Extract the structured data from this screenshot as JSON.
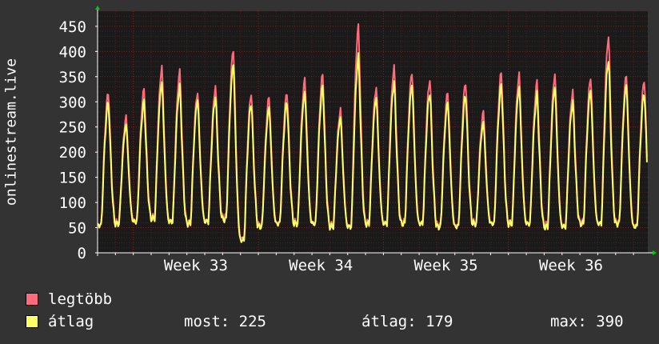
{
  "chart_data": {
    "type": "line",
    "ylabel": "onlinestream.live",
    "ylim": [
      0,
      480
    ],
    "yticks": [
      0,
      50,
      100,
      150,
      200,
      250,
      300,
      350,
      400,
      450
    ],
    "x_tick_labels": [
      "Week 33",
      "Week 34",
      "Week 35",
      "Week 36"
    ],
    "x_tick_days": [
      2,
      9,
      16,
      23
    ],
    "x_range_days": [
      0,
      30.8
    ],
    "grid": true,
    "colors": {
      "max": "#ff6b7a",
      "avg": "#ffff66",
      "grid": "#8b1a1a",
      "axis": "#ffffff",
      "plot_bg": "#1a1a1a",
      "page_bg": "#333333"
    },
    "series": [
      {
        "name": "legtöbb",
        "daily_peaks": [
          320,
          270,
          325,
          370,
          360,
          320,
          330,
          405,
          318,
          310,
          320,
          345,
          355,
          285,
          450,
          330,
          370,
          360,
          345,
          320,
          340,
          280,
          360,
          355,
          340,
          355,
          320,
          350,
          430,
          355,
          345,
          320,
          270
        ],
        "daily_troughs": [
          55,
          60,
          65,
          70,
          65,
          60,
          65,
          70,
          30,
          55,
          60,
          60,
          60,
          55,
          55,
          60,
          60,
          60,
          60,
          55,
          55,
          60,
          60,
          60,
          60,
          55,
          55,
          60,
          60,
          60,
          55,
          55,
          60
        ]
      },
      {
        "name": "átlag",
        "daily_peaks": [
          300,
          255,
          300,
          340,
          330,
          305,
          310,
          375,
          300,
          290,
          300,
          320,
          330,
          270,
          390,
          310,
          340,
          335,
          320,
          300,
          315,
          260,
          335,
          330,
          315,
          330,
          300,
          325,
          385,
          335,
          320,
          300,
          225
        ],
        "daily_troughs": [
          55,
          58,
          62,
          68,
          62,
          58,
          62,
          66,
          25,
          52,
          58,
          58,
          58,
          52,
          52,
          58,
          58,
          58,
          58,
          52,
          52,
          58,
          58,
          58,
          58,
          52,
          52,
          58,
          58,
          58,
          52,
          52,
          58
        ]
      }
    ],
    "legend": [
      {
        "label": "legtöbb",
        "color": "#ff6b7a"
      },
      {
        "label": "átlag",
        "color": "#ffff66"
      }
    ],
    "stats": {
      "most": "most: 225",
      "atlag": "átlag: 179",
      "max": "max: 390"
    }
  }
}
